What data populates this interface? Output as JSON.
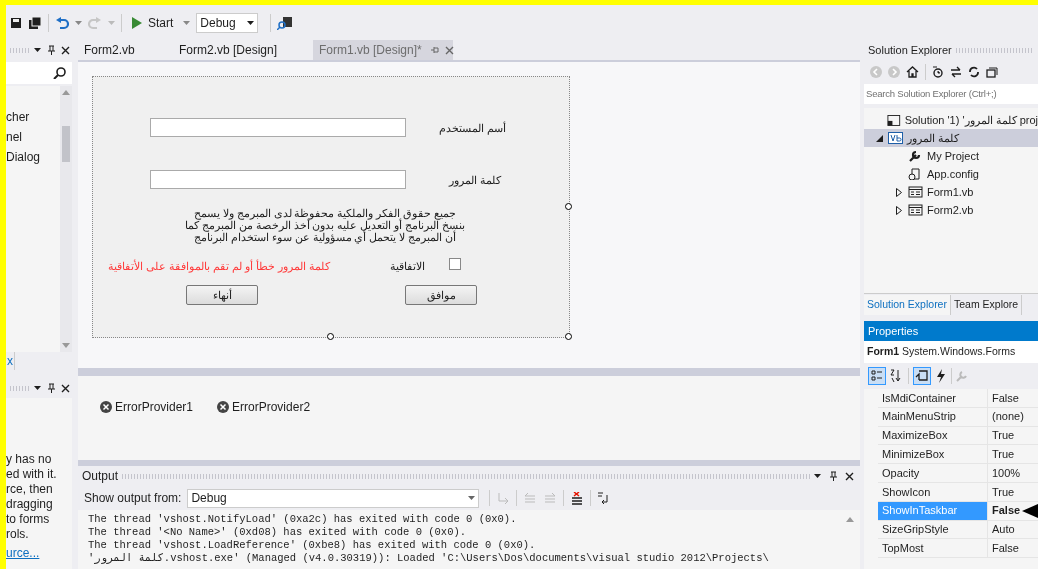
{
  "toolbar": {
    "start_label": "Start",
    "configuration": "Debug"
  },
  "toolbox": {
    "items": [
      "cher",
      "nel",
      "Dialog"
    ],
    "tab": "x"
  },
  "help_panel": {
    "lines": [
      "y has no",
      "ed with it.",
      "rce, then",
      "dragging",
      "to forms",
      "rols."
    ],
    "link": "urce..."
  },
  "doc_tabs": [
    {
      "label": "Form2.vb",
      "selected": false
    },
    {
      "label": "Form2.vb [Design]",
      "selected": false
    },
    {
      "label": "Form1.vb [Design]*",
      "selected": true
    }
  ],
  "form": {
    "fields": [
      {
        "label": "أسم المستخدم"
      },
      {
        "label": "كلمة المرور"
      }
    ],
    "notice": "جميع حقوق الفكر والملكية محفوظة لدى المبرمج ولا يسمح\nبنسخ البرنامج أو التعديل عليه بدون أخذ الرخصة من المبرمج كما\nأن المبرمج لا يتحمل أي مسؤولية عن سوء استخدام البرنامج",
    "agreement": {
      "label": "الاتفاقية",
      "checked": false
    },
    "error": "كلمة المرور خطأ أو لم تقم بالموافقة على الأتفاقية",
    "buttons": [
      "موافق",
      "أنهاء"
    ]
  },
  "tray": [
    "ErrorProvider1",
    "ErrorProvider2"
  ],
  "output": {
    "title": "Output",
    "source_label": "Show output from:",
    "source": "Debug",
    "lines": [
      "The thread 'vshost.NotifyLoad' (0xa2c) has exited with code 0 (0x0).",
      "The thread '<No Name>' (0xd08) has exited with code 0 (0x0).",
      "The thread 'vshost.LoadReference' (0xbe8) has exited with code 0 (0x0).",
      "'كلمة المرور.vshost.exe' (Managed (v4.0.30319)): Loaded 'C:\\Users\\Dos\\documents\\visual studio 2012\\Projects\\"
    ]
  },
  "solution_explorer": {
    "title": "Solution Explorer",
    "search_placeholder": "Search Solution Explorer (Ctrl+;)",
    "tree": [
      {
        "kind": "solution",
        "label": "Solution 'كلمة المرور' (1 proj",
        "selected": false
      },
      {
        "kind": "project",
        "label": "كلمة المرور",
        "selected": true,
        "expanded": true,
        "children": [
          {
            "kind": "wrench",
            "label": "My Project",
            "selected": false
          },
          {
            "kind": "config",
            "label": "App.config",
            "selected": false
          },
          {
            "kind": "form",
            "label": "Form1.vb",
            "selected": false,
            "expanded": false
          },
          {
            "kind": "form",
            "label": "Form2.vb",
            "selected": false,
            "expanded": false
          }
        ]
      }
    ],
    "tabs": [
      {
        "label": "Solution Explorer",
        "selected": true
      },
      {
        "label": "Team Explore",
        "selected": false
      }
    ]
  },
  "properties": {
    "title": "Properties",
    "object": "Form1",
    "type": "System.Windows.Forms",
    "rows": [
      {
        "name": "IsMdiContainer",
        "value": "False",
        "selected": false,
        "modified": false
      },
      {
        "name": "MainMenuStrip",
        "value": "(none)",
        "selected": false,
        "modified": false
      },
      {
        "name": "MaximizeBox",
        "value": "True",
        "selected": false,
        "modified": false
      },
      {
        "name": "MinimizeBox",
        "value": "True",
        "selected": false,
        "modified": false
      },
      {
        "name": "Opacity",
        "value": "100%",
        "selected": false,
        "modified": false
      },
      {
        "name": "ShowIcon",
        "value": "True",
        "selected": false,
        "modified": false
      },
      {
        "name": "ShowInTaskbar",
        "value": "False",
        "selected": true,
        "modified": true
      },
      {
        "name": "SizeGripStyle",
        "value": "Auto",
        "selected": false,
        "modified": false
      },
      {
        "name": "TopMost",
        "value": "False",
        "selected": false,
        "modified": false
      }
    ]
  }
}
